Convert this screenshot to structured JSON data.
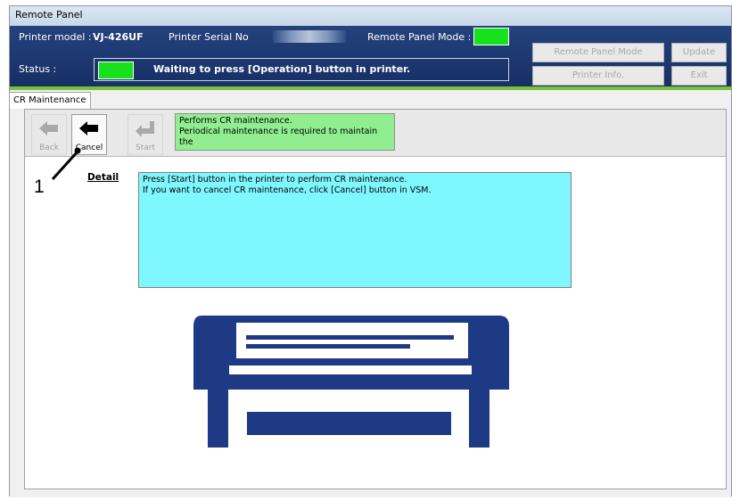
{
  "window": {
    "title": "Remote Panel"
  },
  "header": {
    "printer_model_label": "Printer model :",
    "printer_model_value": "VJ-426UF",
    "serial_label": "Printer Serial No",
    "mode_label": "Remote Panel Mode :",
    "status_label": "Status :",
    "status_text": "Waiting to press [Operation] button in printer.",
    "indicator_color": "#17e01c",
    "buttons": {
      "remote_panel_mode": "Remote Panel Mode",
      "update": "Update",
      "printer_info": "Printer Info.",
      "exit": "Exit"
    }
  },
  "tabs": [
    {
      "label": "CR Maintenance"
    }
  ],
  "toolbar": {
    "back": "Back",
    "cancel": "Cancel",
    "start": "Start"
  },
  "description": {
    "line1": "Performs CR maintenance.",
    "line2": "Periodical maintenance is required to maintain the"
  },
  "detail": {
    "label": "Detail",
    "line1": "Press [Start] button in the printer to perform CR maintenance.",
    "line2": "If you want to cancel CR maintenance, click [Cancel] button in VSM."
  },
  "annotation": {
    "number": "1"
  },
  "colors": {
    "header_bg": "#1f3a73",
    "description_bg": "#90ee90",
    "detail_bg": "#7ff7ff",
    "printer_icon": "#1e3a85"
  }
}
